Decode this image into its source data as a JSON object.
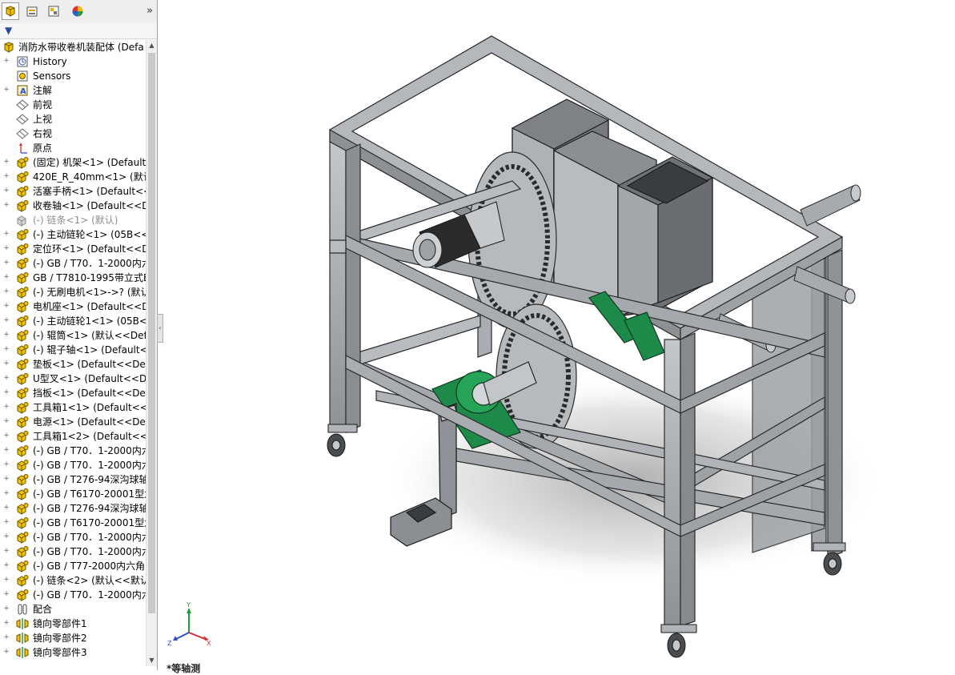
{
  "feature_tree": {
    "root_label": "消防水带收卷机装配体 (Defa",
    "items": [
      {
        "label": "History",
        "icon": "history-icon",
        "expand": true
      },
      {
        "label": "Sensors",
        "icon": "sensor-icon",
        "expand": false
      },
      {
        "label": "注解",
        "icon": "annotation-icon",
        "expand": true
      },
      {
        "label": "前视",
        "icon": "plane-icon",
        "expand": false
      },
      {
        "label": "上视",
        "icon": "plane-icon",
        "expand": false
      },
      {
        "label": "右视",
        "icon": "plane-icon",
        "expand": false
      },
      {
        "label": "原点",
        "icon": "origin-icon",
        "expand": false
      },
      {
        "label": "(固定) 机架<1> (Default<",
        "icon": "part-icon",
        "expand": true
      },
      {
        "label": "420E_R_40mm<1> (默认",
        "icon": "part-icon",
        "expand": true
      },
      {
        "label": "活塞手柄<1> (Default<<",
        "icon": "part-icon",
        "expand": true
      },
      {
        "label": "收卷轴<1> (Default<<De",
        "icon": "part-icon",
        "expand": true
      },
      {
        "label": "(-) 链条<1> (默认)",
        "icon": "part-suppressed-icon",
        "expand": false,
        "suppressed": true
      },
      {
        "label": "(-) 主动链轮<1> (05B<<",
        "icon": "part-icon",
        "expand": true
      },
      {
        "label": "定位环<1> (Default<<De",
        "icon": "part-icon",
        "expand": true
      },
      {
        "label": "(-) GB / T70．1-2000内六",
        "icon": "part-icon",
        "expand": true
      },
      {
        "label": "GB / T7810-1995带立式B",
        "icon": "part-icon",
        "expand": true
      },
      {
        "label": "(-) 无刷电机<1>->? (默认",
        "icon": "part-icon",
        "expand": true
      },
      {
        "label": "电机座<1> (Default<<De",
        "icon": "part-icon",
        "expand": true
      },
      {
        "label": "(-) 主动链轮1<1> (05B<<",
        "icon": "part-icon",
        "expand": true
      },
      {
        "label": "(-) 辊筒<1> (默认<<Defa",
        "icon": "part-icon",
        "expand": true
      },
      {
        "label": "(-) 辊子轴<1> (Default<<",
        "icon": "part-icon",
        "expand": true
      },
      {
        "label": "垫板<1> (Default<<Defa",
        "icon": "part-icon",
        "expand": true
      },
      {
        "label": "U型叉<1> (Default<<De",
        "icon": "part-icon",
        "expand": true
      },
      {
        "label": "挡板<1> (Default<<Defa",
        "icon": "part-icon",
        "expand": true
      },
      {
        "label": "工具箱1<1> (Default<<D",
        "icon": "part-icon",
        "expand": true
      },
      {
        "label": "电源<1> (Default<<Defa",
        "icon": "part-icon",
        "expand": true
      },
      {
        "label": "工具箱1<2> (Default<<D",
        "icon": "part-icon",
        "expand": true
      },
      {
        "label": "(-) GB / T70．1-2000内六",
        "icon": "part-icon",
        "expand": true
      },
      {
        "label": "(-) GB / T70．1-2000内六",
        "icon": "part-icon",
        "expand": true
      },
      {
        "label": "(-) GB / T276-94深沟球轴",
        "icon": "part-icon",
        "expand": true
      },
      {
        "label": "(-) GB / T6170-20001型六",
        "icon": "part-icon",
        "expand": true
      },
      {
        "label": "(-) GB / T276-94深沟球轴",
        "icon": "part-icon",
        "expand": true
      },
      {
        "label": "(-) GB / T6170-20001型六",
        "icon": "part-icon",
        "expand": true
      },
      {
        "label": "(-) GB / T70．1-2000内六",
        "icon": "part-icon",
        "expand": true
      },
      {
        "label": "(-) GB / T70．1-2000内六",
        "icon": "part-icon",
        "expand": true
      },
      {
        "label": "(-) GB / T77-2000内六角",
        "icon": "part-icon",
        "expand": true
      },
      {
        "label": "(-) 链条<2> (默认<<默认",
        "icon": "part-icon",
        "expand": true
      },
      {
        "label": "(-) GB / T70．1-2000内六",
        "icon": "part-icon",
        "expand": true
      },
      {
        "label": "配合",
        "icon": "mate-icon",
        "expand": true
      },
      {
        "label": "镜向零部件1",
        "icon": "mirror-icon",
        "expand": true
      },
      {
        "label": "镜向零部件2",
        "icon": "mirror-icon",
        "expand": true
      },
      {
        "label": "镜向零部件3",
        "icon": "mirror-icon",
        "expand": true
      }
    ]
  },
  "tabs": [
    {
      "name": "feature-manager-tab",
      "icon": "assembly-icon"
    },
    {
      "name": "property-manager-tab",
      "icon": "property-icon"
    },
    {
      "name": "configuration-manager-tab",
      "icon": "config-icon"
    },
    {
      "name": "display-manager-tab",
      "icon": "appearance-icon"
    }
  ],
  "expand_label": "»",
  "filter_label": "▼",
  "triad": {
    "x": "X",
    "y": "Y",
    "z": "Z"
  },
  "bottom_label": "*等轴测",
  "colors": {
    "frame": "#9ea2a6",
    "green": "#1e8a4a",
    "accent": "#e3b400"
  }
}
